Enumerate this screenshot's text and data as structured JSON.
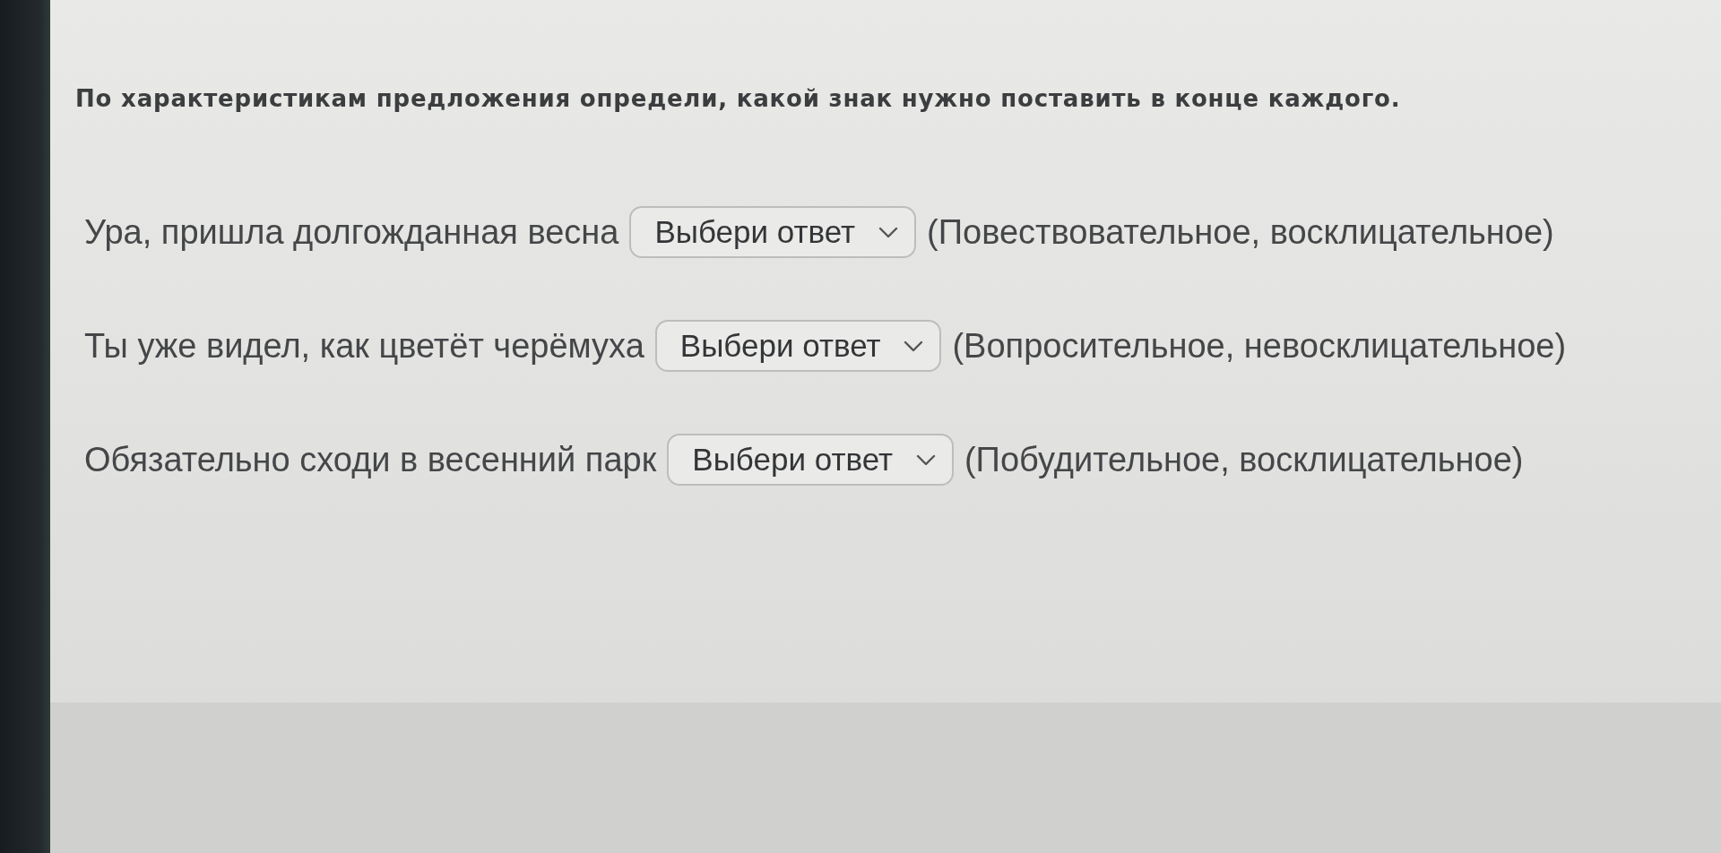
{
  "instruction": "По характеристикам предложения определи, какой знак нужно поставить в конце каждого.",
  "items": [
    {
      "sentence": "Ура, пришла долгожданная весна",
      "select": {
        "placeholder": "Выбери ответ"
      },
      "hint": "(Повествовательное, восклицательное)"
    },
    {
      "sentence": "Ты уже видел, как цветёт черёмуха",
      "select": {
        "placeholder": "Выбери ответ"
      },
      "hint": "(Вопросительное, невосклицательное)"
    },
    {
      "sentence": "Обязательно сходи в весенний парк",
      "select": {
        "placeholder": "Выбери ответ"
      },
      "hint": "(Побудительное, восклицательное)"
    }
  ]
}
